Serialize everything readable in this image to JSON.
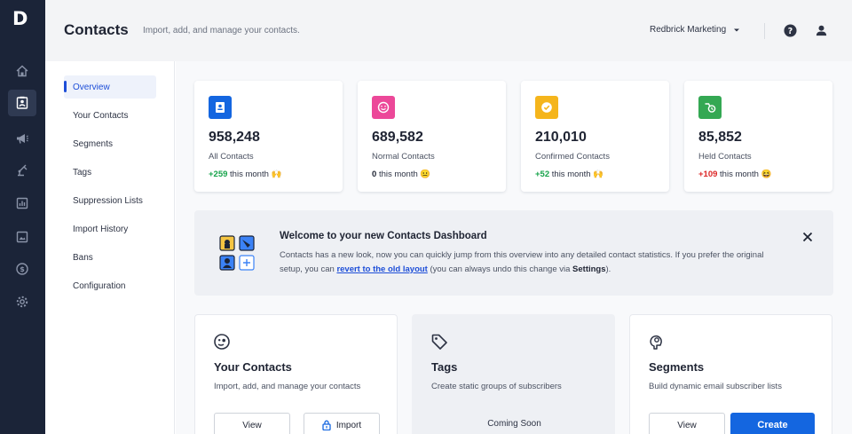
{
  "brand": {
    "logo_letter": "D"
  },
  "rail": {
    "items": [
      {
        "icon": "home-icon"
      },
      {
        "icon": "contacts-icon",
        "active": true
      },
      {
        "icon": "megaphone-icon"
      },
      {
        "icon": "automation-icon"
      },
      {
        "icon": "reports-icon"
      },
      {
        "icon": "templates-icon"
      },
      {
        "icon": "billing-icon"
      },
      {
        "icon": "settings-icon"
      }
    ]
  },
  "header": {
    "title": "Contacts",
    "subtitle": "Import, add, and manage your contacts.",
    "account": "Redbrick Marketing"
  },
  "subnav": {
    "items": [
      {
        "label": "Overview",
        "active": true
      },
      {
        "label": "Your Contacts"
      },
      {
        "label": "Segments"
      },
      {
        "label": "Tags"
      },
      {
        "label": "Suppression Lists"
      },
      {
        "label": "Import History"
      },
      {
        "label": "Bans"
      },
      {
        "label": "Configuration"
      }
    ]
  },
  "stats": [
    {
      "value": "958,248",
      "label": "All Contacts",
      "delta": "+259",
      "suffix": "this month 🙌",
      "icon": "contact-card-icon",
      "color": "#1466e0",
      "delta_color": "#16a34a"
    },
    {
      "value": "689,582",
      "label": "Normal Contacts",
      "delta": "0",
      "suffix": "this month 😐",
      "icon": "smiley-icon",
      "color": "#ec4899",
      "delta_color": "#1f2433"
    },
    {
      "value": "210,010",
      "label": "Confirmed Contacts",
      "delta": "+52",
      "suffix": "this month 🙌",
      "icon": "check-circle-icon",
      "color": "#f5b51c",
      "delta_color": "#16a34a"
    },
    {
      "value": "85,852",
      "label": "Held Contacts",
      "delta": "+109",
      "suffix": "this month 😆",
      "icon": "held-contact-icon",
      "color": "#34a853",
      "delta_color": "#dc2626"
    }
  ],
  "banner": {
    "title": "Welcome to your new Contacts Dashboard",
    "text_1": "Contacts has a new look, now you can quickly jump from this overview into any detailed contact statistics. If you prefer the original setup, you can",
    "link": "revert to the old layout",
    "text_2": "(you can always undo this change via",
    "settings": "Settings",
    "text_3": ")."
  },
  "cards": [
    {
      "title": "Your Contacts",
      "desc": "Import, add, and manage your contacts",
      "icon": "contacts-face-icon",
      "btn_1": "View",
      "btn_2": "Import"
    },
    {
      "title": "Tags",
      "desc": "Create static groups of subscribers",
      "icon": "tag-icon",
      "coming_soon": "Coming Soon"
    },
    {
      "title": "Segments",
      "desc": "Build dynamic email subscriber lists",
      "icon": "segment-icon",
      "btn_1": "View",
      "btn_2": "Create"
    }
  ]
}
